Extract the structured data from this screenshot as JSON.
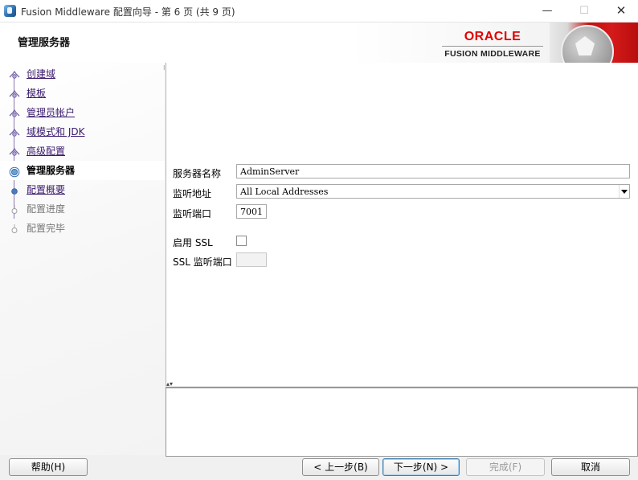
{
  "window": {
    "title": "Fusion Middleware 配置向导 - 第 6 页 (共 9 页)",
    "minimize": "—",
    "maximize": "☐",
    "close": "✕"
  },
  "header": {
    "page_title": "管理服务器",
    "brand_name": "ORACLE",
    "brand_sub": "FUSION MIDDLEWARE"
  },
  "sidebar": {
    "items": [
      {
        "label": "创建域",
        "state": "done"
      },
      {
        "label": "模板",
        "state": "done"
      },
      {
        "label": "管理员帐户",
        "state": "done"
      },
      {
        "label": "域模式和 JDK",
        "state": "done"
      },
      {
        "label": "高级配置",
        "state": "done"
      },
      {
        "label": "管理服务器",
        "state": "current"
      },
      {
        "label": "配置概要",
        "state": "link"
      },
      {
        "label": "配置进度",
        "state": "disabled"
      },
      {
        "label": "配置完毕",
        "state": "disabled"
      }
    ]
  },
  "form": {
    "server_name_label": "服务器名称",
    "server_name_value": "AdminServer",
    "listen_address_label": "监听地址",
    "listen_address_value": "All Local Addresses",
    "listen_port_label": "监听端口",
    "listen_port_value": "7001",
    "enable_ssl_label": "启用 SSL",
    "ssl_port_label": "SSL 监听端口",
    "ssl_port_value": ""
  },
  "buttons": {
    "help": "帮助(H)",
    "back": "< 上一步(B)",
    "next": "下一步(N) >",
    "finish": "完成(F)",
    "cancel": "取消"
  }
}
